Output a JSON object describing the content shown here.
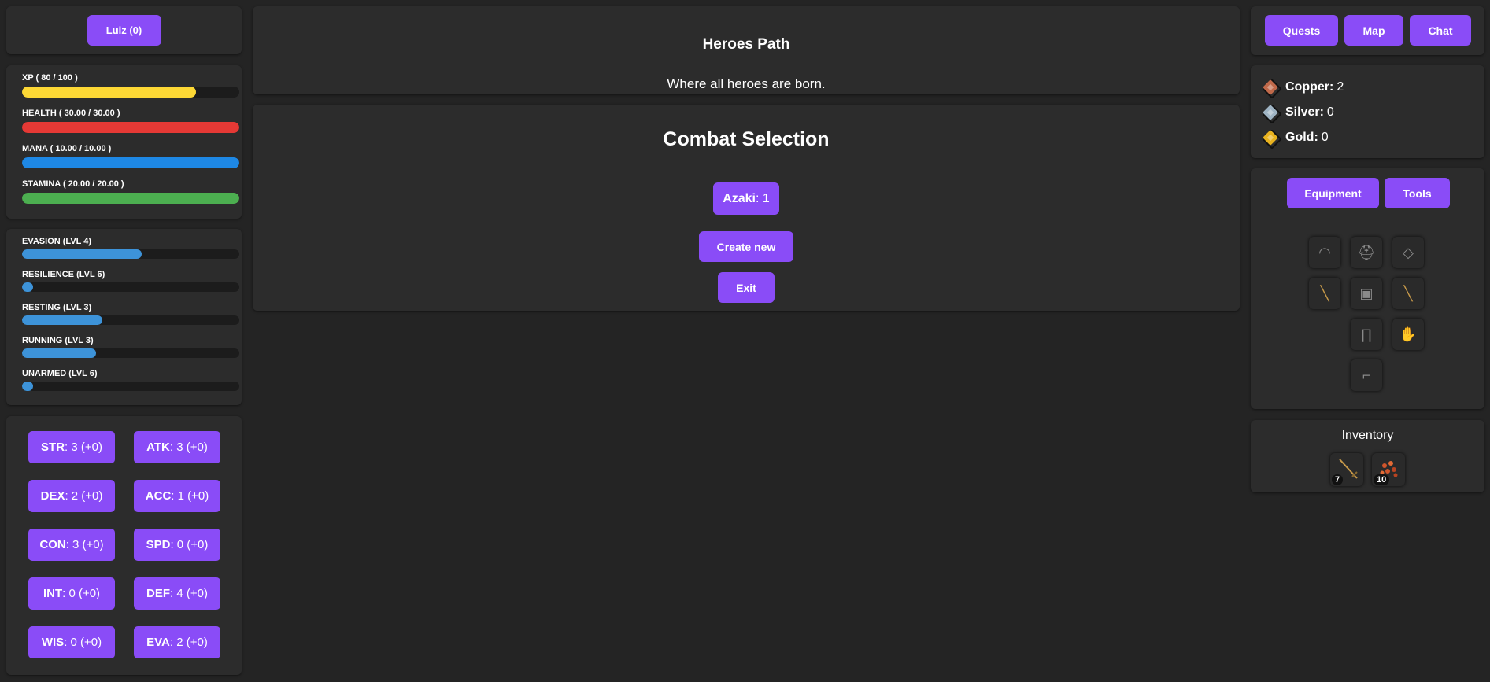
{
  "user": {
    "button_label": "Luiz (0)"
  },
  "bars": [
    {
      "label": "XP ( 80 / 100 )",
      "fraction": 0.8,
      "color": "#fdd835"
    },
    {
      "label": "HEALTH ( 30.00 / 30.00 )",
      "fraction": 1.0,
      "color": "#e53935"
    },
    {
      "label": "MANA ( 10.00 / 10.00 )",
      "fraction": 1.0,
      "color": "#1e88e5"
    },
    {
      "label": "STAMINA ( 20.00 / 20.00 )",
      "fraction": 1.0,
      "color": "#4caf50"
    }
  ],
  "skills": [
    {
      "label": "EVASION (LVL 4)",
      "fraction": 0.55
    },
    {
      "label": "RESILIENCE (LVL 6)",
      "fraction": 0.05
    },
    {
      "label": "RESTING (LVL 3)",
      "fraction": 0.37
    },
    {
      "label": "RUNNING (LVL 3)",
      "fraction": 0.34
    },
    {
      "label": "UNARMED (LVL 6)",
      "fraction": 0.05
    }
  ],
  "stats": [
    {
      "abbr": "STR",
      "value": ": 3 (+0)"
    },
    {
      "abbr": "ATK",
      "value": ": 3 (+0)"
    },
    {
      "abbr": "DEX",
      "value": ": 2 (+0)"
    },
    {
      "abbr": "ACC",
      "value": ": 1 (+0)"
    },
    {
      "abbr": "CON",
      "value": ": 3 (+0)"
    },
    {
      "abbr": "SPD",
      "value": ": 0 (+0)"
    },
    {
      "abbr": "INT",
      "value": ": 0 (+0)"
    },
    {
      "abbr": "DEF",
      "value": ": 4 (+0)"
    },
    {
      "abbr": "WIS",
      "value": ": 0 (+0)"
    },
    {
      "abbr": "EVA",
      "value": ": 2 (+0)"
    }
  ],
  "location": {
    "title": "Heroes Path",
    "subtitle": "Where all heroes are born."
  },
  "combat": {
    "title": "Combat Selection",
    "entry_name": "Azaki",
    "entry_value": ": 1",
    "create_label": "Create new",
    "exit_label": "Exit"
  },
  "nav": {
    "quests": "Quests",
    "map": "Map",
    "chat": "Chat"
  },
  "currency": [
    {
      "label": "Copper:",
      "value": "2",
      "color": "#c0694a",
      "icon": "copper-coin-icon"
    },
    {
      "label": "Silver:",
      "value": "0",
      "color": "#9fb4c4",
      "icon": "silver-coin-icon"
    },
    {
      "label": "Gold:",
      "value": "0",
      "color": "#e8b21f",
      "icon": "gold-coin-icon"
    }
  ],
  "equipment": {
    "tab_equipment": "Equipment",
    "tab_tools": "Tools",
    "slots": [
      {
        "name": "headgear-slot",
        "icon": "circlet-icon",
        "glyph": "◠"
      },
      {
        "name": "helmet-slot",
        "icon": "helmet-icon",
        "glyph": "⛑"
      },
      {
        "name": "amulet-slot",
        "icon": "amulet-icon",
        "glyph": "◇"
      },
      {
        "name": "main-hand-slot",
        "icon": "sword-icon",
        "glyph": "╲"
      },
      {
        "name": "chest-slot",
        "icon": "armor-icon",
        "glyph": "▣"
      },
      {
        "name": "off-hand-slot",
        "icon": "sword-icon",
        "glyph": "╲"
      },
      {
        "name": "legs-slot",
        "icon": "pants-icon",
        "glyph": "∏"
      },
      {
        "name": "gloves-slot",
        "icon": "gloves-icon",
        "glyph": "✋"
      },
      {
        "name": "boots-slot",
        "icon": "boots-icon",
        "glyph": "⌐"
      }
    ]
  },
  "inventory": {
    "title": "Inventory",
    "items": [
      {
        "icon": "sword-icon",
        "count": "7"
      },
      {
        "icon": "ore-icon",
        "count": "10"
      }
    ]
  }
}
